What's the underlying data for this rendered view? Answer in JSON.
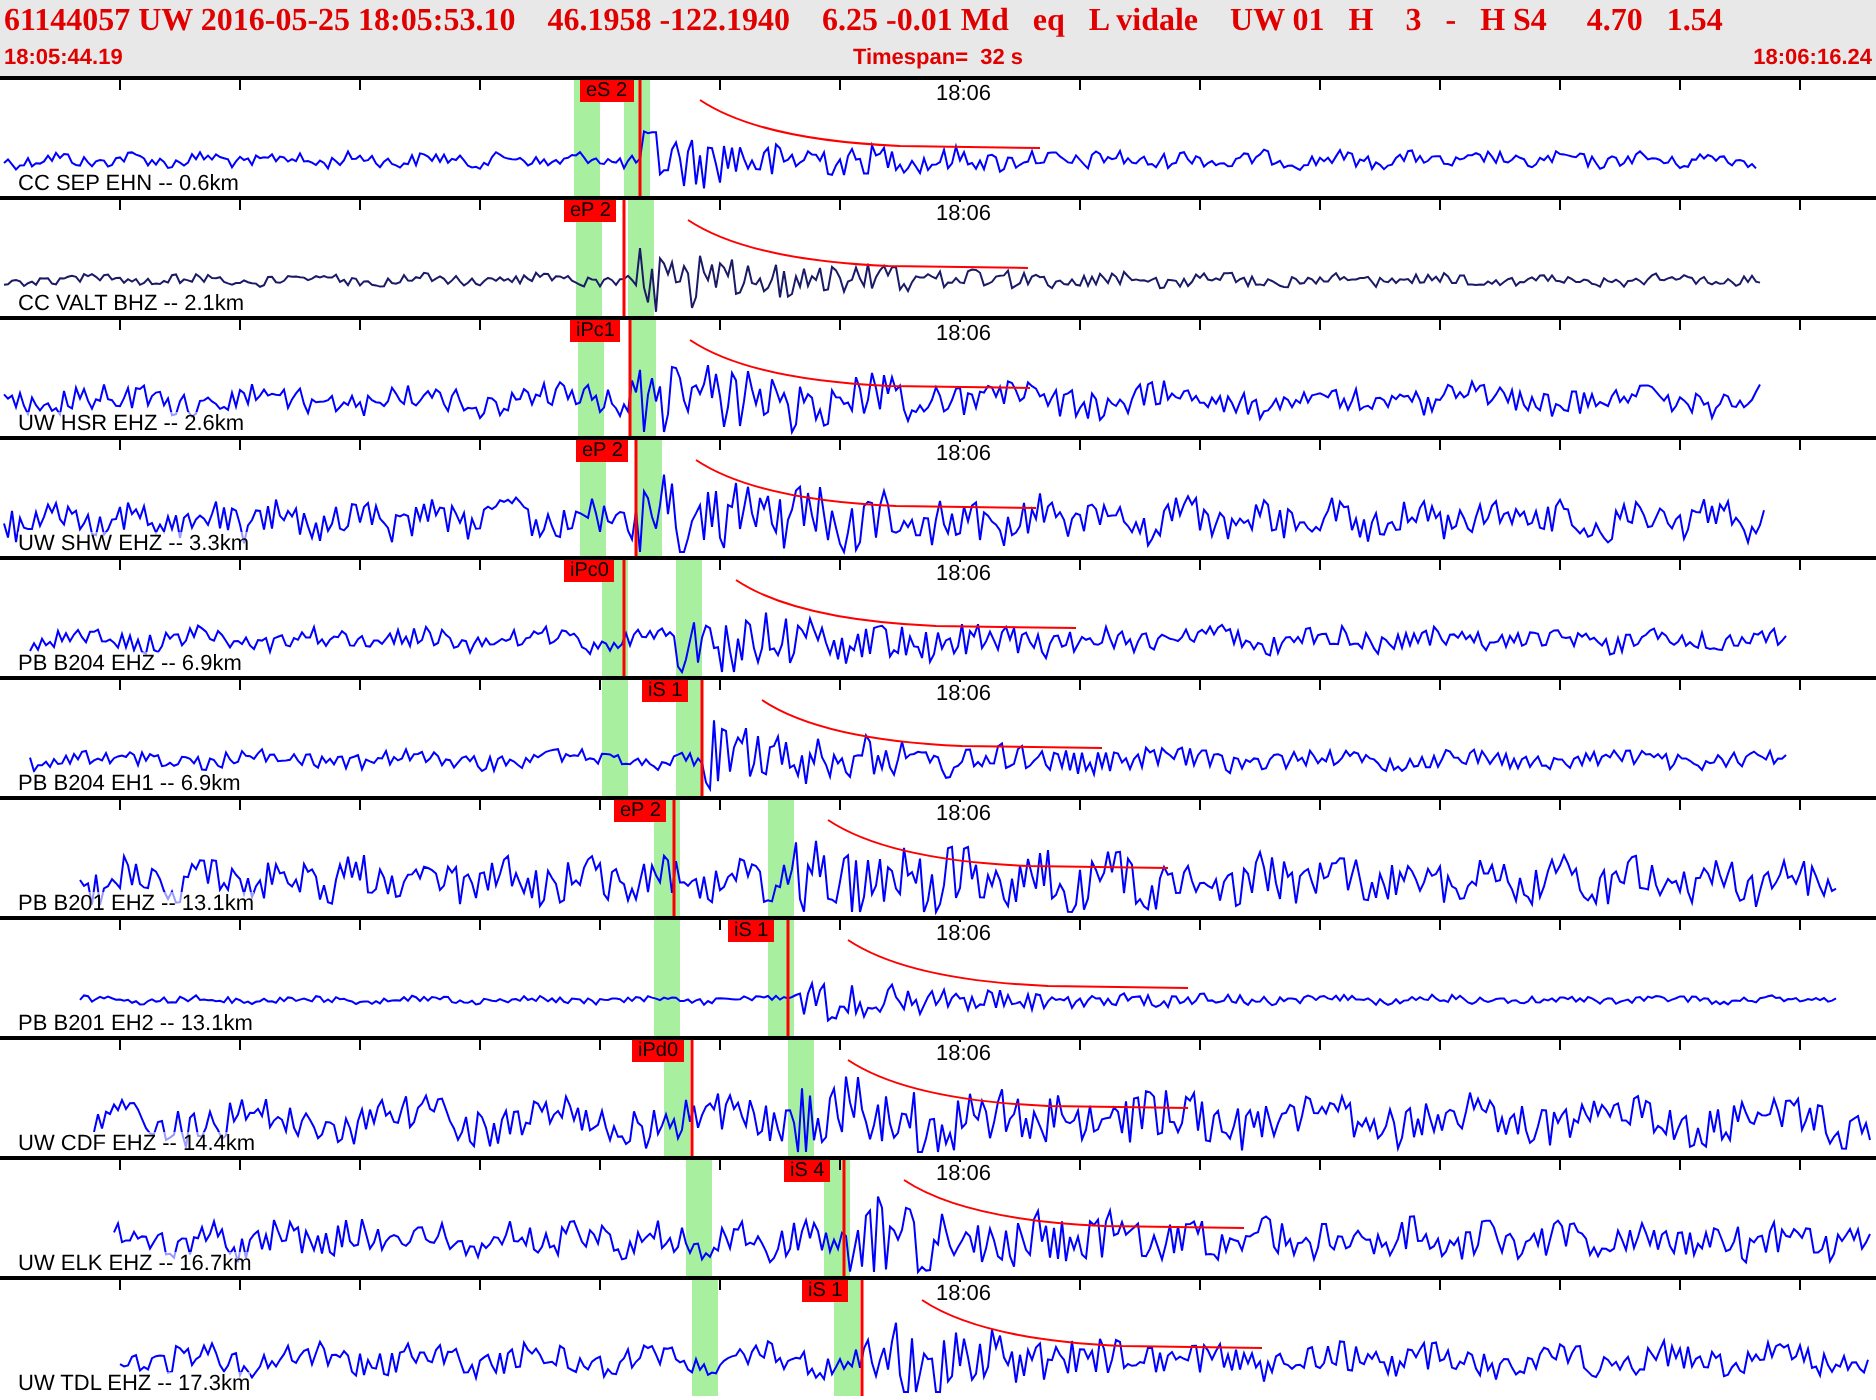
{
  "header": {
    "title": "61144057 UW 2016-05-25 18:05:53.10    46.1958 -122.1940    6.25 -0.01 Md   eq   L vidale    UW 01   H    3   -   H S4     4.70   1.54",
    "start_time": "18:05:44.19",
    "timespan": "Timespan=  32 s",
    "end_time": "18:06:16.24"
  },
  "traces": [
    {
      "station": "CC SEP EHN -- 0.6km",
      "pick": "eS 2",
      "time_mark": "18:06",
      "color": "#0000ff"
    },
    {
      "station": "CC VALT BHZ -- 2.1km",
      "pick": "eP 2",
      "time_mark": "18:06",
      "color": "#1a1a66"
    },
    {
      "station": "UW HSR EHZ -- 2.6km",
      "pick": "iPc1",
      "time_mark": "18:06",
      "color": "#0000ff"
    },
    {
      "station": "UW SHW EHZ -- 3.3km",
      "pick": "eP 2",
      "time_mark": "18:06",
      "color": "#0000ff"
    },
    {
      "station": "PB B204 EHZ -- 6.9km",
      "pick": "iPc0",
      "time_mark": "18:06",
      "color": "#0000ff"
    },
    {
      "station": "PB B204 EH1 -- 6.9km",
      "pick": "iS 1",
      "time_mark": "18:06",
      "color": "#0000ff"
    },
    {
      "station": "PB B201 EHZ -- 13.1km",
      "pick": "eP 2",
      "time_mark": "18:06",
      "color": "#0000ff"
    },
    {
      "station": "PB B201 EH2 -- 13.1km",
      "pick": "iS 1",
      "time_mark": "18:06",
      "color": "#0000ff"
    },
    {
      "station": "UW CDF EHZ -- 14.4km",
      "pick": "iPd0",
      "time_mark": "18:06",
      "color": "#0000ff"
    },
    {
      "station": "UW ELK EHZ -- 16.7km",
      "pick": "iS 4",
      "time_mark": "18:06",
      "color": "#0000ff"
    },
    {
      "station": "UW TDL EHZ -- 17.3km",
      "pick": "iS 1",
      "time_mark": "18:06",
      "color": "#0000ff"
    }
  ]
}
